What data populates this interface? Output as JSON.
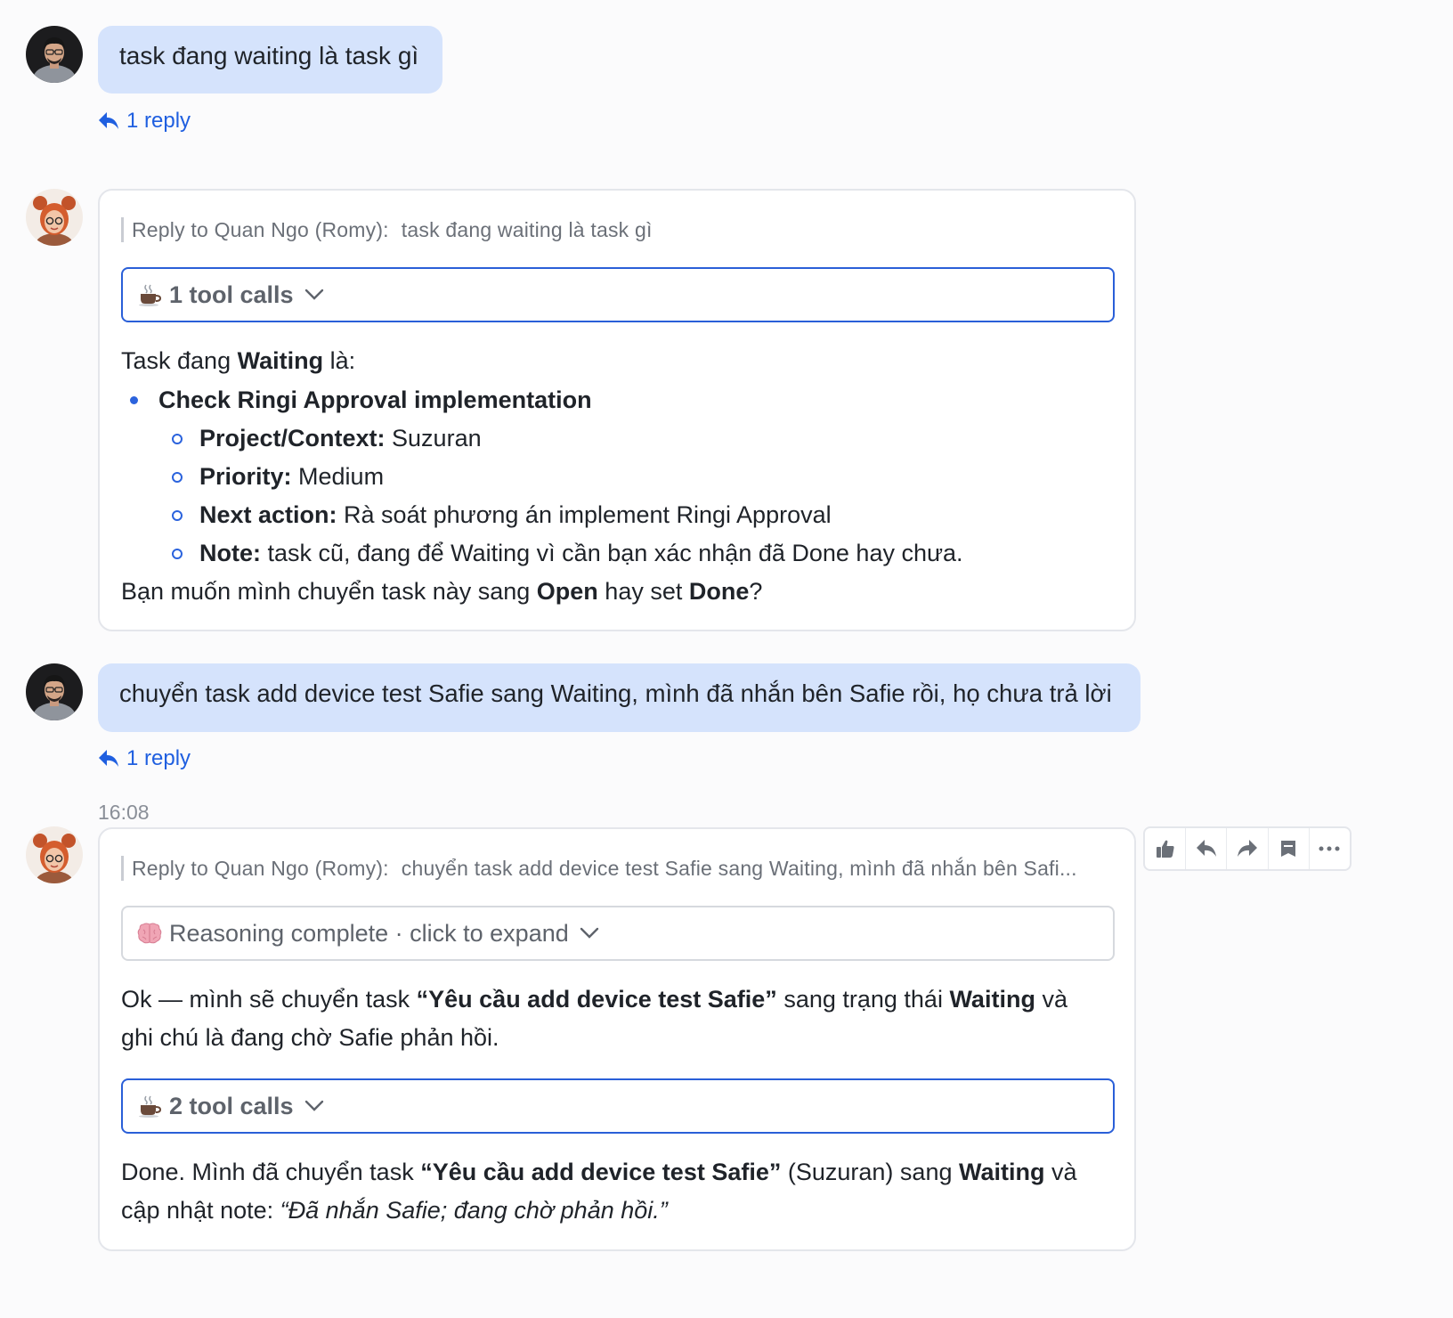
{
  "messages": [
    {
      "text": "task đang waiting là task gì",
      "reply_count": "1 reply"
    },
    {
      "reply_label": "Reply to Quan Ngo (Romy):",
      "reply_quote": "task đang waiting là task gì",
      "tool_calls": "1 tool calls",
      "intro_a": "Task đang ",
      "intro_b": "Waiting",
      "intro_c": " là:",
      "task_title": "Check Ringi Approval implementation",
      "details": [
        {
          "label": "Project/Context:",
          "value": " Suzuran"
        },
        {
          "label": "Priority:",
          "value": " Medium"
        },
        {
          "label": "Next action:",
          "value": " Rà soát phương án implement Ringi Approval"
        },
        {
          "label": "Note:",
          "value": " task cũ, đang để Waiting vì cần bạn xác nhận đã Done hay chưa."
        }
      ],
      "question_a": "Bạn muốn mình chuyển task này sang ",
      "question_b": "Open",
      "question_c": " hay set ",
      "question_d": "Done",
      "question_e": "?"
    },
    {
      "text": "chuyển task add device test Safie sang Waiting, mình đã nhắn bên Safie rồi, họ chưa trả lời",
      "reply_count": "1 reply"
    },
    {
      "timestamp": "16:08",
      "reply_label": "Reply to Quan Ngo (Romy):",
      "reply_quote": "chuyển task add device test Safie sang Waiting, mình đã nhắn bên Safi...",
      "reasoning": "Reasoning complete · click to expand",
      "ok_a": "Ok — mình sẽ chuyển task ",
      "ok_b": "“Yêu cầu add device test Safie”",
      "ok_c": " sang trạng thái ",
      "ok_d": "Waiting",
      "ok_e": " và",
      "ok_line2": "ghi chú là đang chờ Safie phản hồi.",
      "tool_calls": "2 tool calls",
      "done_a": "Done. Mình đã chuyển task ",
      "done_b": "“Yêu cầu add device test Safie”",
      "done_c": " (Suzuran) sang ",
      "done_d": "Waiting",
      "done_e": " và",
      "done_line2_a": "cập nhật note: ",
      "done_line2_b": "“Đã nhắn Safie; đang chờ phản hồi.”"
    }
  ],
  "icons": {
    "tool": "coffee-icon",
    "reasoning": "brain-icon",
    "reply": "reply-arrow-icon",
    "actions": [
      "thumbs-up-icon",
      "reply-icon",
      "forward-icon",
      "archive-icon",
      "more-icon"
    ]
  },
  "colors": {
    "user_bubble": "#d5e3fc",
    "link_blue": "#1f5fe0",
    "tool_border_blue": "#2a5fd8",
    "bullet_blue": "#2b63dd"
  }
}
